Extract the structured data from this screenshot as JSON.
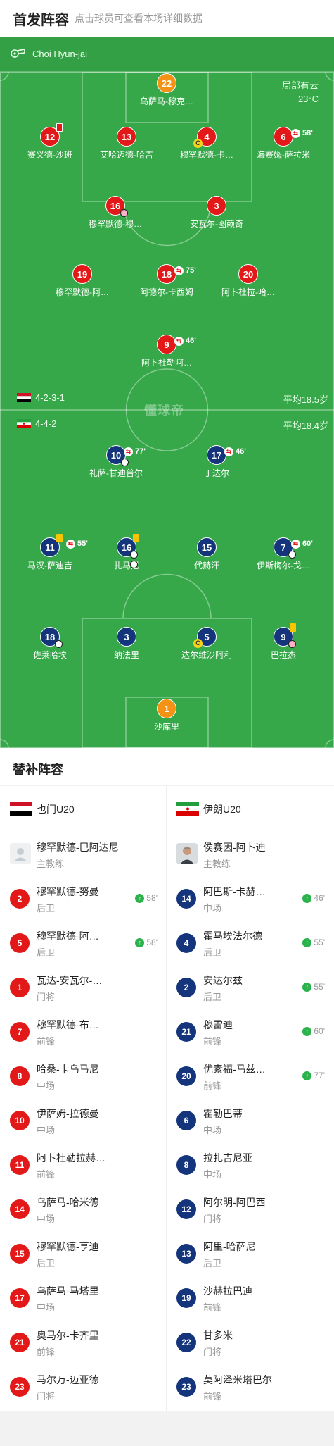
{
  "header": {
    "title": "首发阵容",
    "hint": "点击球员可查看本场详细数据"
  },
  "referee": {
    "name": "Choi Hyun-jai",
    "icon": "whistle-icon"
  },
  "weather": {
    "condition": "局部有云",
    "temperature": "23°C"
  },
  "home_team": {
    "name": "也门U20",
    "formation": "4-2-3-1",
    "avg_age": "平均18.5岁",
    "flag": "yemen-flag",
    "players": [
      {
        "number": "22",
        "name": "乌萨马-穆克…",
        "color": "orange"
      },
      {
        "number": "12",
        "name": "赛义德-沙班",
        "card": "red"
      },
      {
        "number": "13",
        "name": "艾哈迈德-哈吉"
      },
      {
        "number": "4",
        "name": "穆罕默德-卡…",
        "captain": "C"
      },
      {
        "number": "6",
        "name": "海赛姆-萨拉米",
        "sub_minute": "58'"
      },
      {
        "number": "16",
        "name": "穆罕默德-穆…",
        "ball": "pink"
      },
      {
        "number": "3",
        "name": "安瓦尔-图赖奇"
      },
      {
        "number": "19",
        "name": "穆罕默德-阿…"
      },
      {
        "number": "18",
        "name": "阿德尔-卡西姆",
        "sub_minute": "75'"
      },
      {
        "number": "20",
        "name": "阿卜杜拉-哈…"
      },
      {
        "number": "9",
        "name": "阿卜杜勒阿…",
        "sub_minute": "46'"
      }
    ]
  },
  "away_team": {
    "name": "伊朗U20",
    "formation": "4-4-2",
    "avg_age": "平均18.4岁",
    "flag": "iran-flag",
    "players": [
      {
        "number": "10",
        "name": "礼萨-甘迪普尔",
        "sub_minute": "77'",
        "goals": 1
      },
      {
        "number": "17",
        "name": "丁达尔",
        "sub_minute": "46'"
      },
      {
        "number": "11",
        "name": "马汉-萨迪吉",
        "card": "yellow",
        "sub_minute": "55'"
      },
      {
        "number": "16",
        "name": "扎马尼",
        "card": "yellow",
        "goals": 2
      },
      {
        "number": "15",
        "name": "代赫汗"
      },
      {
        "number": "7",
        "name": "伊斯梅尔-戈…",
        "sub_minute": "60'",
        "goals": 1
      },
      {
        "number": "18",
        "name": "佐莱哈埃",
        "goals": 1
      },
      {
        "number": "3",
        "name": "纳法里"
      },
      {
        "number": "5",
        "name": "达尔维沙阿利",
        "captain": "C"
      },
      {
        "number": "9",
        "name": "巴拉杰",
        "card": "yellow",
        "ball": "pink"
      },
      {
        "number": "1",
        "name": "沙库里",
        "color": "orange"
      }
    ]
  },
  "watermark": "懂球帝",
  "subs": {
    "title": "替补阵容",
    "home": {
      "team_name": "也门U20",
      "coach": {
        "name": "穆罕默德-巴阿达尼",
        "role": "主教练"
      },
      "players": [
        {
          "number": "2",
          "name": "穆罕默德-努曼",
          "position": "后卫",
          "sub_in": "58'"
        },
        {
          "number": "5",
          "name": "穆罕默德-阿…",
          "position": "后卫",
          "sub_in": "58'"
        },
        {
          "number": "1",
          "name": "瓦达-安瓦尔-…",
          "position": "门将"
        },
        {
          "number": "7",
          "name": "穆罕默德-布…",
          "position": "前锋"
        },
        {
          "number": "8",
          "name": "哈桑-卡乌马尼",
          "position": "中场"
        },
        {
          "number": "10",
          "name": "伊萨姆-拉德曼",
          "position": "中场"
        },
        {
          "number": "11",
          "name": "阿卜杜勒拉赫…",
          "position": "前锋"
        },
        {
          "number": "14",
          "name": "乌萨马-哈米德",
          "position": "中场"
        },
        {
          "number": "15",
          "name": "穆罕默德-亨迪",
          "position": "后卫"
        },
        {
          "number": "17",
          "name": "乌萨马-马塔里",
          "position": "中场"
        },
        {
          "number": "21",
          "name": "奥马尔-卡齐里",
          "position": "前锋"
        },
        {
          "number": "23",
          "name": "马尔万-迈亚德",
          "position": "门将"
        }
      ]
    },
    "away": {
      "team_name": "伊朗U20",
      "coach": {
        "name": "侯赛因-阿卜迪",
        "role": "主教练"
      },
      "players": [
        {
          "number": "14",
          "name": "阿巴斯-卡赫…",
          "position": "中场",
          "sub_in": "46'"
        },
        {
          "number": "4",
          "name": "霍马埃法尔德",
          "position": "后卫",
          "sub_in": "55'"
        },
        {
          "number": "2",
          "name": "安达尔兹",
          "position": "后卫",
          "sub_in": "55'"
        },
        {
          "number": "21",
          "name": "穆雷迪",
          "position": "前锋",
          "sub_in": "60'"
        },
        {
          "number": "20",
          "name": "优素福-马兹…",
          "position": "前锋",
          "sub_in": "77'"
        },
        {
          "number": "6",
          "name": "霍勒巴蒂",
          "position": "中场"
        },
        {
          "number": "8",
          "name": "拉扎吉尼亚",
          "position": "中场"
        },
        {
          "number": "12",
          "name": "阿尔明-阿巴西",
          "position": "门将"
        },
        {
          "number": "13",
          "name": "阿里-哈萨尼",
          "position": "后卫"
        },
        {
          "number": "19",
          "name": "沙赫拉巴迪",
          "position": "前锋"
        },
        {
          "number": "22",
          "name": "甘多米",
          "position": "门将"
        },
        {
          "number": "23",
          "name": "莫阿泽米塔巴尔",
          "position": "前锋"
        }
      ]
    }
  }
}
